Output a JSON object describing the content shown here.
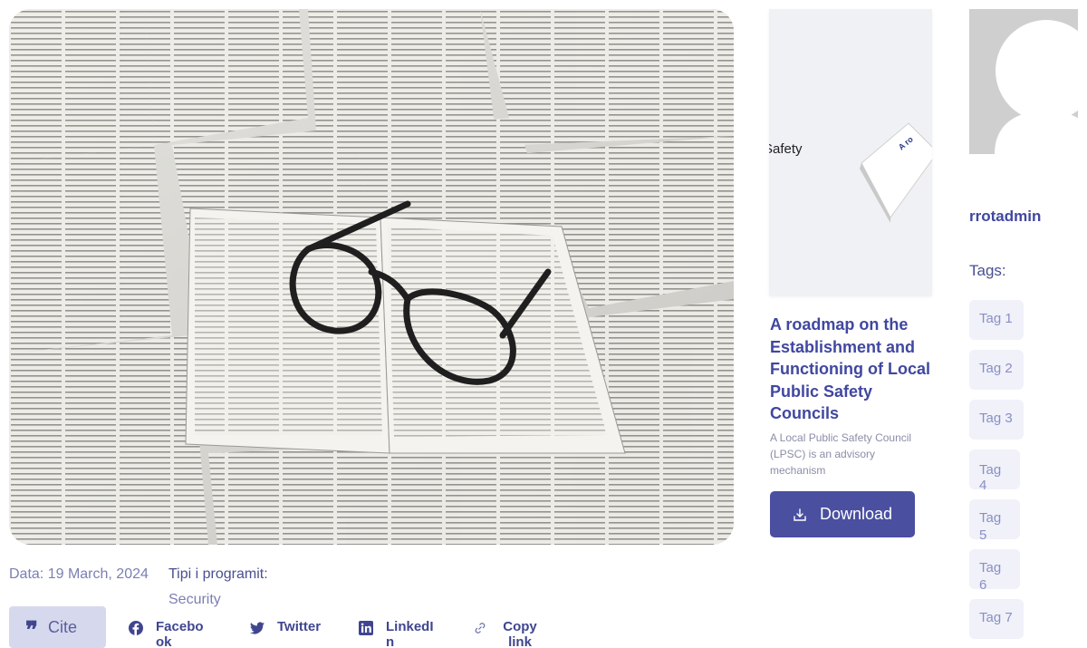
{
  "hero": {
    "icon": "open-books-with-glasses-photo"
  },
  "meta": {
    "date_label": "Data:",
    "date_value": "19 March, 2024",
    "program_label": "Tipi i programit:",
    "program_value": "Security"
  },
  "share": {
    "cite_label": "Cite",
    "facebook": "Facebook",
    "twitter": "Twitter",
    "linkedin": "LinkedIn",
    "copy_link": "Copy link"
  },
  "document": {
    "thumb_text": "Safety",
    "title": "A roadmap on the Establishment and Functioning of Local Public Safety Councils",
    "description": "A Local Public Safety Council (LPSC)  is an advisory mechanism",
    "download_label": "Download"
  },
  "sidebar": {
    "author": "rrotadmin",
    "tags_label": "Tags:",
    "tags": [
      "Tag 1",
      "Tag 2",
      "Tag 3",
      "Tag 4",
      "Tag 5",
      "Tag 6",
      "Tag 7"
    ]
  },
  "colors": {
    "accent": "#4a4fa0",
    "tag_bg": "#f0f1f9",
    "cite_bg": "#d6d8ee"
  }
}
